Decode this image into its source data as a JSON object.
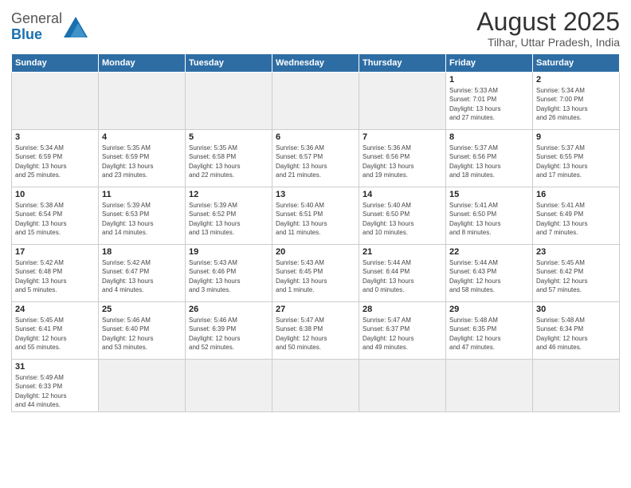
{
  "header": {
    "logo_general": "General",
    "logo_blue": "Blue",
    "month_year": "August 2025",
    "location": "Tilhar, Uttar Pradesh, India"
  },
  "weekdays": [
    "Sunday",
    "Monday",
    "Tuesday",
    "Wednesday",
    "Thursday",
    "Friday",
    "Saturday"
  ],
  "weeks": [
    [
      {
        "day": "",
        "empty": true
      },
      {
        "day": "",
        "empty": true
      },
      {
        "day": "",
        "empty": true
      },
      {
        "day": "",
        "empty": true
      },
      {
        "day": "",
        "empty": true
      },
      {
        "day": "1",
        "info": "Sunrise: 5:33 AM\nSunset: 7:01 PM\nDaylight: 13 hours\nand 27 minutes."
      },
      {
        "day": "2",
        "info": "Sunrise: 5:34 AM\nSunset: 7:00 PM\nDaylight: 13 hours\nand 26 minutes."
      }
    ],
    [
      {
        "day": "3",
        "info": "Sunrise: 5:34 AM\nSunset: 6:59 PM\nDaylight: 13 hours\nand 25 minutes."
      },
      {
        "day": "4",
        "info": "Sunrise: 5:35 AM\nSunset: 6:59 PM\nDaylight: 13 hours\nand 23 minutes."
      },
      {
        "day": "5",
        "info": "Sunrise: 5:35 AM\nSunset: 6:58 PM\nDaylight: 13 hours\nand 22 minutes."
      },
      {
        "day": "6",
        "info": "Sunrise: 5:36 AM\nSunset: 6:57 PM\nDaylight: 13 hours\nand 21 minutes."
      },
      {
        "day": "7",
        "info": "Sunrise: 5:36 AM\nSunset: 6:56 PM\nDaylight: 13 hours\nand 19 minutes."
      },
      {
        "day": "8",
        "info": "Sunrise: 5:37 AM\nSunset: 6:56 PM\nDaylight: 13 hours\nand 18 minutes."
      },
      {
        "day": "9",
        "info": "Sunrise: 5:37 AM\nSunset: 6:55 PM\nDaylight: 13 hours\nand 17 minutes."
      }
    ],
    [
      {
        "day": "10",
        "info": "Sunrise: 5:38 AM\nSunset: 6:54 PM\nDaylight: 13 hours\nand 15 minutes."
      },
      {
        "day": "11",
        "info": "Sunrise: 5:39 AM\nSunset: 6:53 PM\nDaylight: 13 hours\nand 14 minutes."
      },
      {
        "day": "12",
        "info": "Sunrise: 5:39 AM\nSunset: 6:52 PM\nDaylight: 13 hours\nand 13 minutes."
      },
      {
        "day": "13",
        "info": "Sunrise: 5:40 AM\nSunset: 6:51 PM\nDaylight: 13 hours\nand 11 minutes."
      },
      {
        "day": "14",
        "info": "Sunrise: 5:40 AM\nSunset: 6:50 PM\nDaylight: 13 hours\nand 10 minutes."
      },
      {
        "day": "15",
        "info": "Sunrise: 5:41 AM\nSunset: 6:50 PM\nDaylight: 13 hours\nand 8 minutes."
      },
      {
        "day": "16",
        "info": "Sunrise: 5:41 AM\nSunset: 6:49 PM\nDaylight: 13 hours\nand 7 minutes."
      }
    ],
    [
      {
        "day": "17",
        "info": "Sunrise: 5:42 AM\nSunset: 6:48 PM\nDaylight: 13 hours\nand 5 minutes."
      },
      {
        "day": "18",
        "info": "Sunrise: 5:42 AM\nSunset: 6:47 PM\nDaylight: 13 hours\nand 4 minutes."
      },
      {
        "day": "19",
        "info": "Sunrise: 5:43 AM\nSunset: 6:46 PM\nDaylight: 13 hours\nand 3 minutes."
      },
      {
        "day": "20",
        "info": "Sunrise: 5:43 AM\nSunset: 6:45 PM\nDaylight: 13 hours\nand 1 minute."
      },
      {
        "day": "21",
        "info": "Sunrise: 5:44 AM\nSunset: 6:44 PM\nDaylight: 13 hours\nand 0 minutes."
      },
      {
        "day": "22",
        "info": "Sunrise: 5:44 AM\nSunset: 6:43 PM\nDaylight: 12 hours\nand 58 minutes."
      },
      {
        "day": "23",
        "info": "Sunrise: 5:45 AM\nSunset: 6:42 PM\nDaylight: 12 hours\nand 57 minutes."
      }
    ],
    [
      {
        "day": "24",
        "info": "Sunrise: 5:45 AM\nSunset: 6:41 PM\nDaylight: 12 hours\nand 55 minutes."
      },
      {
        "day": "25",
        "info": "Sunrise: 5:46 AM\nSunset: 6:40 PM\nDaylight: 12 hours\nand 53 minutes."
      },
      {
        "day": "26",
        "info": "Sunrise: 5:46 AM\nSunset: 6:39 PM\nDaylight: 12 hours\nand 52 minutes."
      },
      {
        "day": "27",
        "info": "Sunrise: 5:47 AM\nSunset: 6:38 PM\nDaylight: 12 hours\nand 50 minutes."
      },
      {
        "day": "28",
        "info": "Sunrise: 5:47 AM\nSunset: 6:37 PM\nDaylight: 12 hours\nand 49 minutes."
      },
      {
        "day": "29",
        "info": "Sunrise: 5:48 AM\nSunset: 6:35 PM\nDaylight: 12 hours\nand 47 minutes."
      },
      {
        "day": "30",
        "info": "Sunrise: 5:48 AM\nSunset: 6:34 PM\nDaylight: 12 hours\nand 46 minutes."
      }
    ],
    [
      {
        "day": "31",
        "info": "Sunrise: 5:49 AM\nSunset: 6:33 PM\nDaylight: 12 hours\nand 44 minutes."
      },
      {
        "day": "",
        "empty": true
      },
      {
        "day": "",
        "empty": true
      },
      {
        "day": "",
        "empty": true
      },
      {
        "day": "",
        "empty": true
      },
      {
        "day": "",
        "empty": true
      },
      {
        "day": "",
        "empty": true
      }
    ]
  ]
}
